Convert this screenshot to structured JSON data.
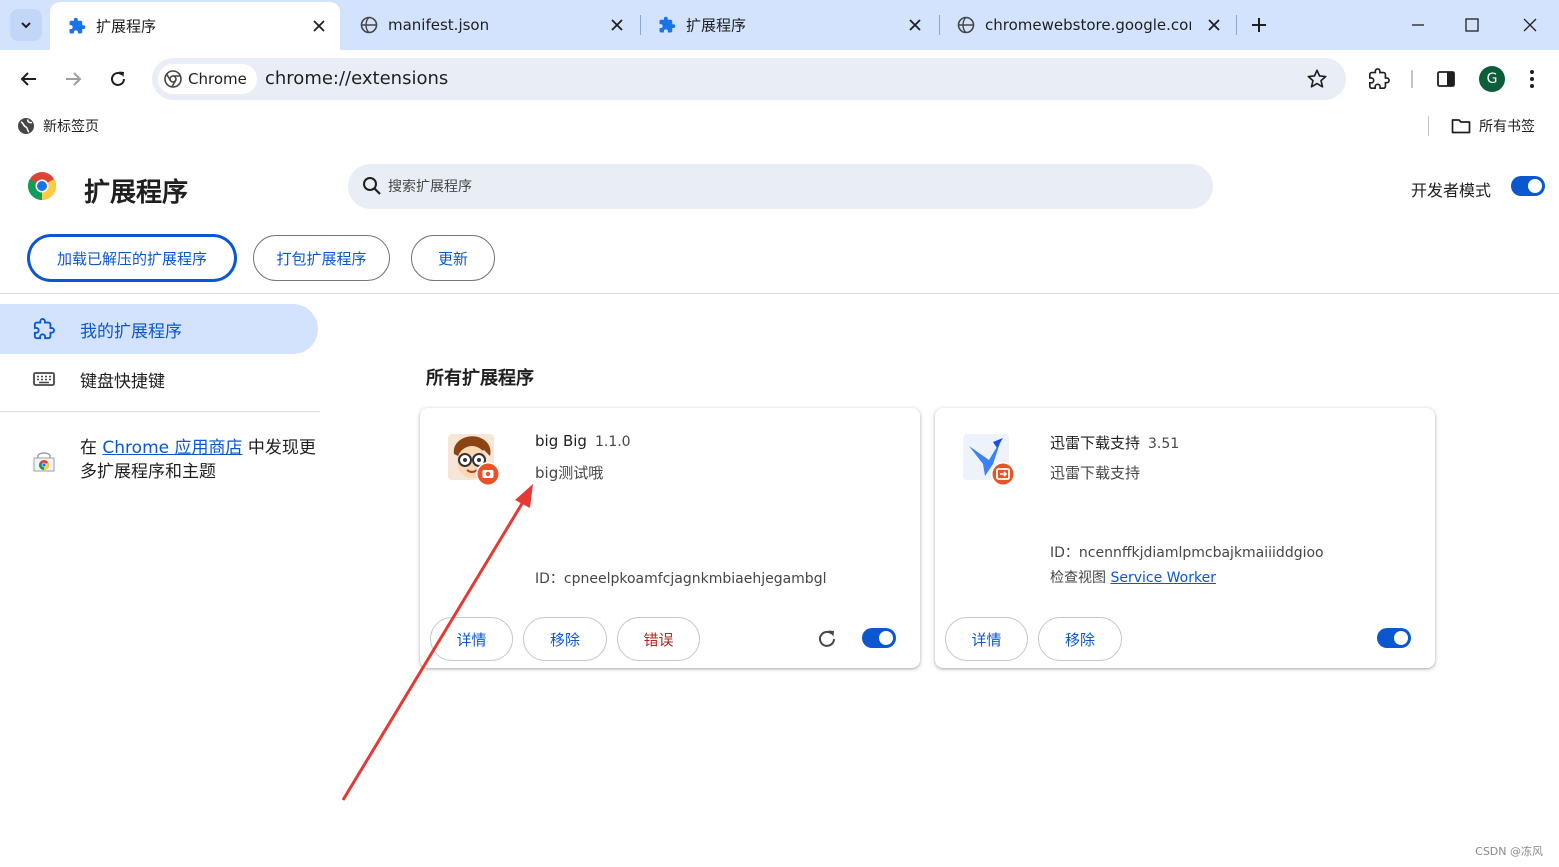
{
  "tabs": [
    {
      "title": "扩展程序",
      "icon": "puzzle-icon",
      "active": true
    },
    {
      "title": "manifest.json",
      "icon": "globe-icon",
      "active": false
    },
    {
      "title": "扩展程序",
      "icon": "puzzle-icon",
      "active": false
    },
    {
      "title": "chromewebstore.google.com",
      "icon": "globe-icon",
      "active": false
    }
  ],
  "toolbar": {
    "chip_label": "Chrome",
    "url": "chrome://extensions",
    "avatar_letter": "G"
  },
  "bookmarks": {
    "left_item": "新标签页",
    "right_item": "所有书签"
  },
  "header": {
    "title": "扩展程序",
    "search_placeholder": "搜索扩展程序",
    "dev_mode_label": "开发者模式",
    "dev_mode_on": true,
    "buttons": [
      "加载已解压的扩展程序",
      "打包扩展程序",
      "更新"
    ]
  },
  "sidebar": {
    "items": [
      {
        "label": "我的扩展程序",
        "icon": "extension-icon",
        "selected": true
      },
      {
        "label": "键盘快捷键",
        "icon": "keyboard-icon",
        "selected": false
      }
    ],
    "promo_prefix": "在 ",
    "promo_link": "Chrome 应用商店",
    "promo_suffix": " 中发现更多扩展程序和主题"
  },
  "main": {
    "section_title": "所有扩展程序",
    "extensions": [
      {
        "name": "big Big",
        "version": "1.1.0",
        "description": "big测试哦",
        "id_line": "ID：cpneelpkoamfcjagnkmbiaehjegambgl",
        "inspect_label": "",
        "inspect_link": "",
        "buttons": [
          "详情",
          "移除",
          "错误"
        ],
        "enabled": true,
        "has_reload": true
      },
      {
        "name": "迅雷下载支持",
        "version": "3.51",
        "description": "迅雷下载支持",
        "id_line": "ID：ncennffkjdiamlpmcbajkmaiiiddgioo",
        "inspect_label": "检查视图 ",
        "inspect_link": "Service Worker",
        "buttons": [
          "详情",
          "移除"
        ],
        "enabled": true,
        "has_reload": false
      }
    ]
  },
  "watermark": "CSDN @冻风",
  "colors": {
    "accent": "#0b57d0",
    "tabstrip": "#d3e3fd",
    "error": "#b3261e",
    "annotation": "#e53935"
  }
}
